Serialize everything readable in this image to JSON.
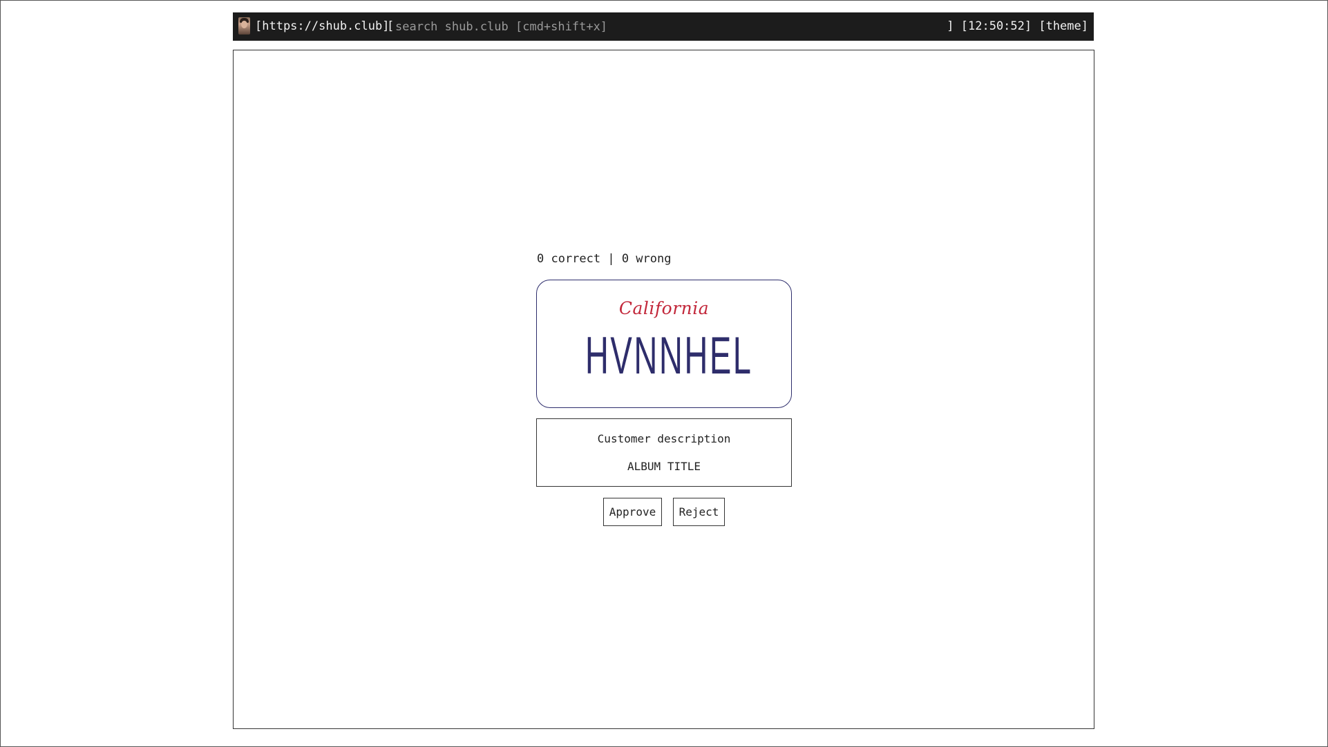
{
  "topbar": {
    "avatar_alt": "user avatar",
    "url": "[https://shub.club]",
    "search_open_bracket": "[",
    "search_placeholder": "search shub.club [cmd+shift+x]",
    "search_value": "",
    "right_text": "] [12:50:52] [theme]"
  },
  "game": {
    "score_text": "0 correct | 0 wrong",
    "plate": {
      "state": "California",
      "number": "HVNNHEL",
      "state_color": "#c2273a",
      "number_color": "#2e2d6b"
    },
    "description": {
      "label": "Customer description",
      "value": "ALBUM TITLE"
    },
    "buttons": {
      "approve": "Approve",
      "reject": "Reject"
    }
  },
  "colors": {
    "topbar_bg": "#1c1c1c",
    "topbar_text": "#f2f2f2",
    "placeholder": "#9a9a9a",
    "border": "#333333"
  }
}
